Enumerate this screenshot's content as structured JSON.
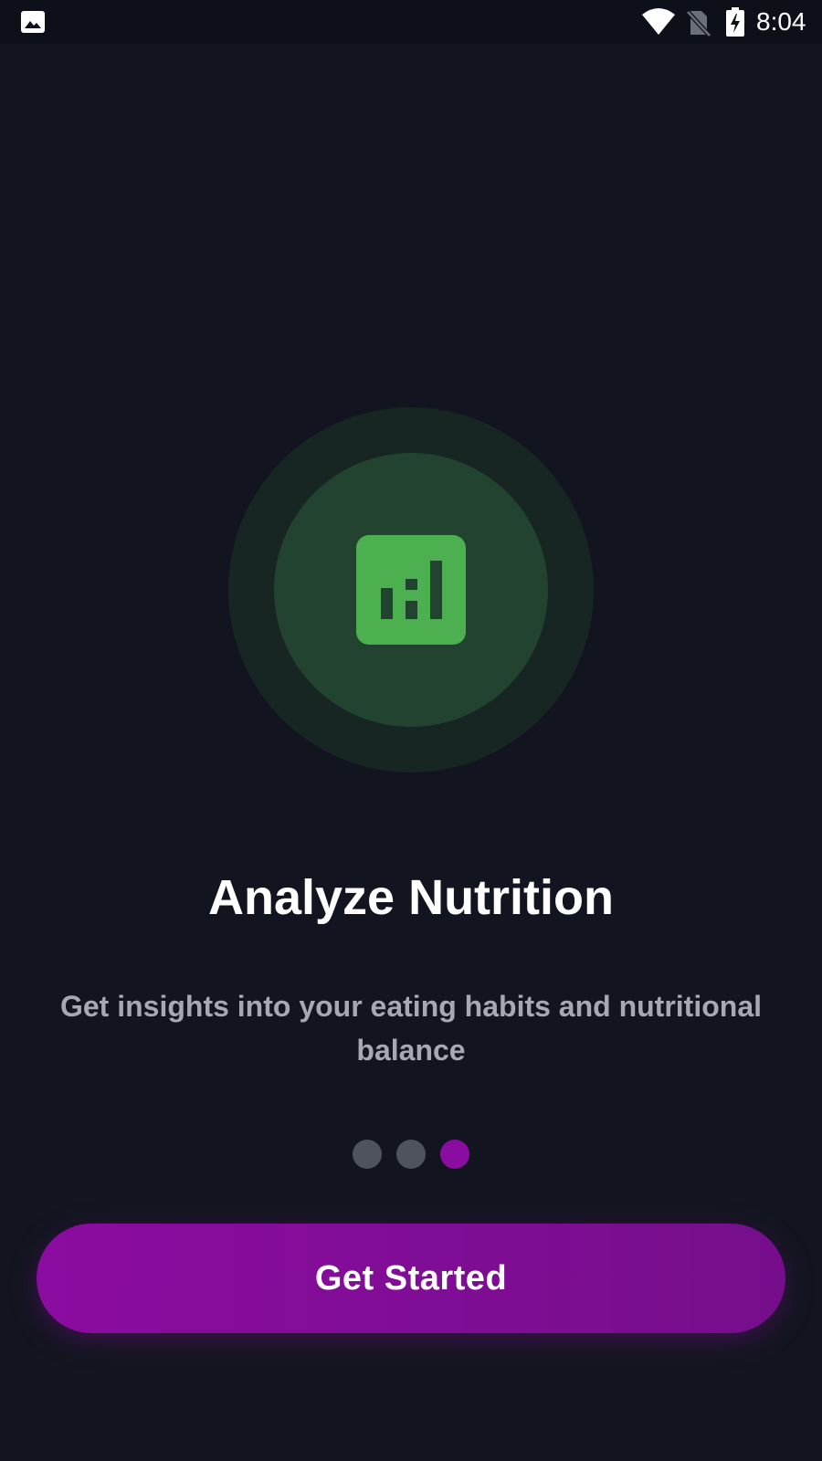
{
  "status_bar": {
    "time": "8:04",
    "left_icon": "image-icon",
    "right_icons": [
      "wifi-icon",
      "no-sim-icon",
      "battery-charging-icon"
    ]
  },
  "onboarding": {
    "illustration_icon": "bar-chart-icon",
    "title": "Analyze Nutrition",
    "description": "Get insights into your eating habits and nutritional balance",
    "page_count": 3,
    "active_page": 3
  },
  "cta": {
    "label": "Get Started"
  },
  "colors": {
    "background": "#12151f",
    "accent": "#8b0ca0",
    "icon_green": "#4caf50",
    "dot_inactive": "#4f535c"
  }
}
